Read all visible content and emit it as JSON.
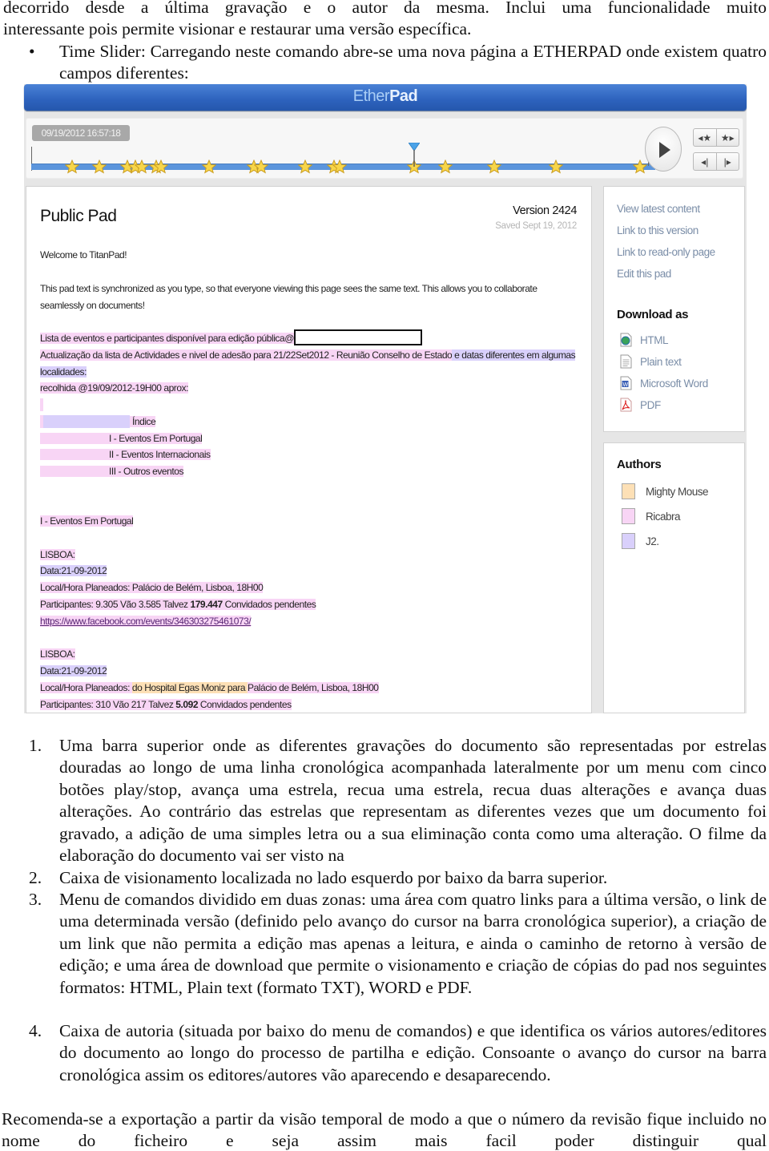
{
  "intro": {
    "line1": "decorrido desde a última gravação e o autor da mesma. Inclui uma funcionalidade muito",
    "line2": "interessante pois permite visionar e restaurar uma versão específica.",
    "bullet_marker": "•",
    "bullet_text": "Time Slider: Carregando neste comando abre-se uma nova página a ETHERPAD onde existem quatro campos diferentes:"
  },
  "etherpad": {
    "logo_part1": "Ether",
    "logo_part2": "Pad",
    "timeslider": {
      "timestamp": "09/19/2012 16:57:18",
      "star_positions_pct": [
        6.6,
        11.1,
        15.6,
        16.9,
        17.9,
        20.3,
        21.0,
        28.8,
        36.1,
        37.3,
        44.4,
        49.1,
        50.0,
        62.1,
        67.1,
        75.0,
        85.1,
        98.7
      ],
      "cursor_pct": 62.1,
      "buttons": {
        "play": "play-stop",
        "prev_star": "◂★",
        "next_star": "★▸",
        "step_back": "◂|",
        "step_forward": "|▸"
      }
    },
    "pad": {
      "title": "Public Pad",
      "version": "Version 2424",
      "saved": "Saved Sept 19, 2012",
      "welcome": "Welcome to TitanPad!",
      "sync_line1": "This pad text is synchronized as you type, so that everyone viewing this page sees the same text.  This allows you to collaborate",
      "sync_line2": "seamlessly on documents!",
      "lista": "Lista de eventos e participantes disponível para edição pública@",
      "actualizacao_a": " Actualização da lista de Actividades e nivel de adesão para 21/22Set2012 - Reunião Conselho de Estado",
      "actualizacao_b": " e datas diferentes em algumas",
      "localidades": "localidades:",
      "recolhida": " recolhida @19/09/2012-19H00 aprox:",
      "indice": "Índice",
      "index_items": [
        "I - Eventos Em Portugal",
        "II - Eventos Internacionais",
        "III - Outros eventos"
      ],
      "section_heading": "I - Eventos Em Portugal",
      "event1": {
        "city": "LISBOA:",
        "date": "Data:21-09-2012",
        "local": "Local/Hora Planeados:  Palácio de Belém, Lisboa, 18H00",
        "participants_a": "Participantes: 9.305 Vão 3.585 Talvez ",
        "participants_bold": "179.447",
        "participants_b": " Convidados pendentes",
        "link": "https://www.facebook.com/events/346303275461073/"
      },
      "event2": {
        "city": "LISBOA:",
        "date": "Data:21-09-2012",
        "local_a": "Local/Hora Planeados: ",
        "local_peach": " do Hospital Egas Moniz para ",
        "local_b": "Palácio de Belém, Lisboa, 18H00",
        "participants_a": "Participantes: 310 Vão 217 Talvez ",
        "participants_bold": "5.092",
        "participants_b": " Convidados pendentes"
      }
    },
    "commands": {
      "links": [
        "View latest content",
        "Link to this version",
        "Link to read-only page",
        "Edit this pad"
      ],
      "download_heading": "Download as",
      "downloads": [
        {
          "label": "HTML",
          "icon": "html-file-icon"
        },
        {
          "label": "Plain text",
          "icon": "text-file-icon"
        },
        {
          "label": "Microsoft Word",
          "icon": "word-file-icon"
        },
        {
          "label": "PDF",
          "icon": "pdf-file-icon"
        }
      ]
    },
    "authors": {
      "heading": "Authors",
      "list": [
        {
          "name": "Mighty Mouse",
          "color": "#fde0b6"
        },
        {
          "name": "Ricabra",
          "color": "#f8d5f5"
        },
        {
          "name": "J2.",
          "color": "#d9d0fb"
        }
      ]
    }
  },
  "list": [
    {
      "num": "1.",
      "text": "Uma barra superior onde as diferentes gravações do documento são representadas por estrelas douradas ao longo de uma linha cronológica acompanhada lateralmente por um menu com cinco botões play/stop, avança uma estrela, recua uma estrela, recua duas alterações e avança duas alterações. Ao contrário das estrelas que representam as diferentes vezes que um documento foi gravado, a adição de uma simples letra ou a sua eliminação conta como uma alteração. O filme da elaboração do documento vai ser visto na"
    },
    {
      "num": "2.",
      "text": "Caixa de visionamento localizada no lado esquerdo por baixo da barra superior."
    },
    {
      "num": "3.",
      "text": "Menu de comandos dividido em duas zonas: uma área com quatro links para a última versão, o link de uma determinada versão (definido pelo avanço do cursor na barra cronológica superior), a criação de um link que não permita a edição mas apenas a leitura, e ainda o caminho de retorno à versão de edição; e uma área de download que permite o visionamento e criação de cópias do pad nos seguintes formatos: HTML, Plain text (formato TXT), WORD e PDF."
    },
    {
      "num": "4.",
      "text": "Caixa de autoria (situada por baixo do menu de comandos) e que identifica os vários autores/editores do documento ao longo do processo de partilha e edição. Consoante o avanço do cursor na barra cronológica assim os editores/autores vão aparecendo e desaparecendo."
    }
  ],
  "closing": "Recomenda-se a exportação a partir da visão temporal de modo a que o número da revisão fique incluido no nome do ficheiro e seja assim mais facil poder distinguir qual"
}
